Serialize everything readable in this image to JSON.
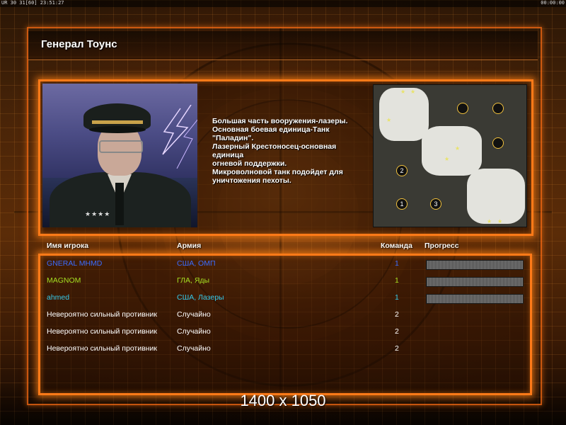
{
  "topbar": {
    "left_text": "UR 30 31[60] 23:51:27",
    "right_text": "00:00:00"
  },
  "header": {
    "title": "Генерал Тоунс"
  },
  "briefing": {
    "description": "Большая часть вооружения-лазеры.\nОсновная боевая единица-Танк\n \"Паладин\".\nЛазерный Крестоносец-основная\n единица\nогневой поддержки.\nМикроволновой танк подойдет для\n уничтожения пехоты."
  },
  "minimap": {
    "start_positions": [
      "1",
      "2",
      "3"
    ]
  },
  "players": {
    "headers": {
      "name": "Имя игрока",
      "army": "Армия",
      "team": "Команда",
      "progress": "Прогресс"
    },
    "rows": [
      {
        "name": "GNERAL MHMD",
        "army": "США, ОМП",
        "team": "1",
        "color": "#3b6cff",
        "progress": 0
      },
      {
        "name": "MAGNOM",
        "army": "ГЛА, Яды",
        "team": "1",
        "color": "#a6e022",
        "progress": 0
      },
      {
        "name": "ahmed",
        "army": "США, Лазеры",
        "team": "1",
        "color": "#35c8e8",
        "progress": 0
      },
      {
        "name": "Невероятно сильный противник",
        "army": "Случайно",
        "team": "2",
        "color": "#ffffff",
        "progress": null
      },
      {
        "name": "Невероятно сильный противник",
        "army": "Случайно",
        "team": "2",
        "color": "#ffffff",
        "progress": null
      },
      {
        "name": "Невероятно сильный противник",
        "army": "Случайно",
        "team": "2",
        "color": "#ffffff",
        "progress": null
      }
    ]
  },
  "overlay": {
    "resolution_text": "1400 x 1050"
  },
  "colors": {
    "accent": "#ff7a18"
  }
}
